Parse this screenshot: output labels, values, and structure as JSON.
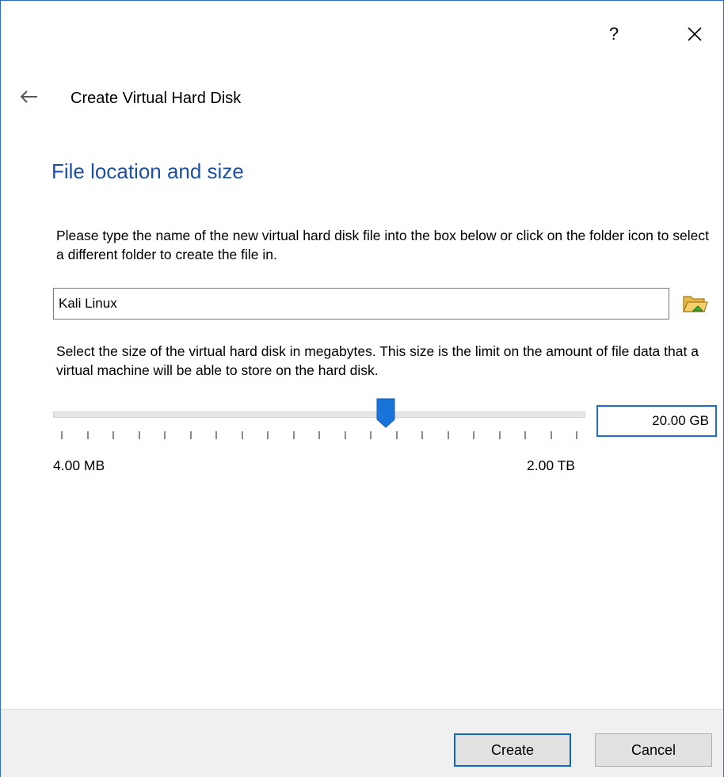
{
  "window": {
    "help_label": "?",
    "wizard_title": "Create Virtual Hard Disk"
  },
  "page": {
    "heading": "File location and size",
    "location_description": "Please type the name of the new virtual hard disk file into the box below or click on the folder icon to select a different folder to create the file in.",
    "file_name_value": "Kali Linux",
    "size_description": "Select the size of the virtual hard disk in megabytes. This size is the limit on the amount of file data that a virtual machine will be able to store on the hard disk.",
    "size_value": "20.00 GB",
    "slider_position_fraction": 0.63,
    "tick_count": 21,
    "range_min": "4.00 MB",
    "range_max": "2.00 TB"
  },
  "footer": {
    "create_label": "Create",
    "cancel_label": "Cancel"
  },
  "colors": {
    "accent": "#1e4fa6",
    "focus_border": "#1f6fd0",
    "slider_thumb": "#1a73d9",
    "folder_icon": "#e0a82e"
  },
  "icons": {
    "back": "back-arrow-icon",
    "close": "close-icon",
    "folder": "folder-icon"
  }
}
